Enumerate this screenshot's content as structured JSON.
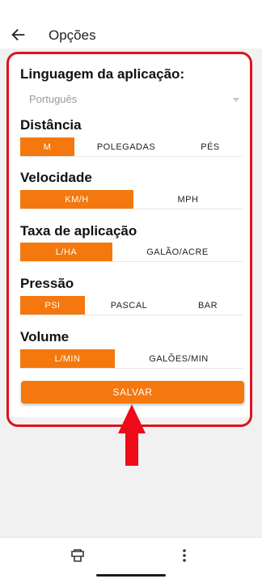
{
  "header": {
    "title": "Opções"
  },
  "language": {
    "label": "Linguagem da aplicação:",
    "value": "Português"
  },
  "sections": {
    "distance": {
      "title": "Distância",
      "options": [
        "M",
        "POLEGADAS",
        "PÉS"
      ],
      "selected": 0
    },
    "speed": {
      "title": "Velocidade",
      "options": [
        "KM/H",
        "MPH"
      ],
      "selected": 0
    },
    "rate": {
      "title": "Taxa de aplicação",
      "options": [
        "L/HA",
        "GALÃO/ACRE"
      ],
      "selected": 0
    },
    "pressure": {
      "title": "Pressão",
      "options": [
        "PSI",
        "PASCAL",
        "BAR"
      ],
      "selected": 0
    },
    "volume": {
      "title": "Volume",
      "options": [
        "L/MIN",
        "GALÕES/MIN"
      ],
      "selected": 0
    }
  },
  "save_label": "SALVAR",
  "colors": {
    "accent": "#f4780d",
    "highlight": "#e3101d"
  },
  "bottom_bar": {
    "icons": [
      "print-icon",
      "more-vertical-icon"
    ]
  }
}
